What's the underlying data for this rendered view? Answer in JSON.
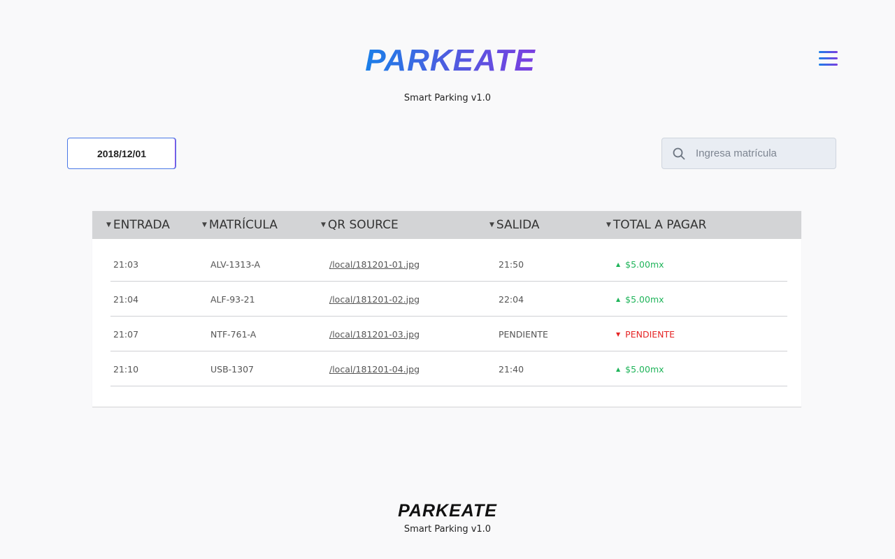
{
  "header": {
    "logo_text": "PARKEATE",
    "subtitle": "Smart Parking v1.0",
    "menu_icon": "hamburger-menu-icon"
  },
  "toolbar": {
    "date": "2018/12/01",
    "search_placeholder": "Ingresa matrícula",
    "search_icon": "search-icon"
  },
  "table": {
    "columns": [
      "ENTRADA",
      "MATRÍCULA",
      "QR SOURCE",
      "SALIDA",
      "TOTAL A PAGAR"
    ],
    "rows": [
      {
        "entrada": "21:03",
        "matricula": "ALV-1313-A",
        "qr": "/local/181201-01.jpg",
        "salida": "21:50",
        "total": "$5.00mx",
        "status": "paid"
      },
      {
        "entrada": "21:04",
        "matricula": "ALF-93-21",
        "qr": "/local/181201-02.jpg",
        "salida": "22:04",
        "total": "$5.00mx",
        "status": "paid"
      },
      {
        "entrada": "21:07",
        "matricula": "NTF-761-A",
        "qr": "/local/181201-03.jpg",
        "salida": "PENDIENTE",
        "total": "PENDIENTE",
        "status": "pending"
      },
      {
        "entrada": "21:10",
        "matricula": "USB-1307",
        "qr": "/local/181201-04.jpg",
        "salida": "21:40",
        "total": "$5.00mx",
        "status": "paid"
      }
    ]
  },
  "footer": {
    "logo_text": "PARKEATE",
    "subtitle": "Smart Parking v1.0"
  },
  "colors": {
    "brand_gradient_start": "#1a7fe8",
    "brand_gradient_end": "#7a3ee0",
    "paid": "#1fb45a",
    "pending": "#e52424",
    "header_bg": "#d3d4d6"
  }
}
